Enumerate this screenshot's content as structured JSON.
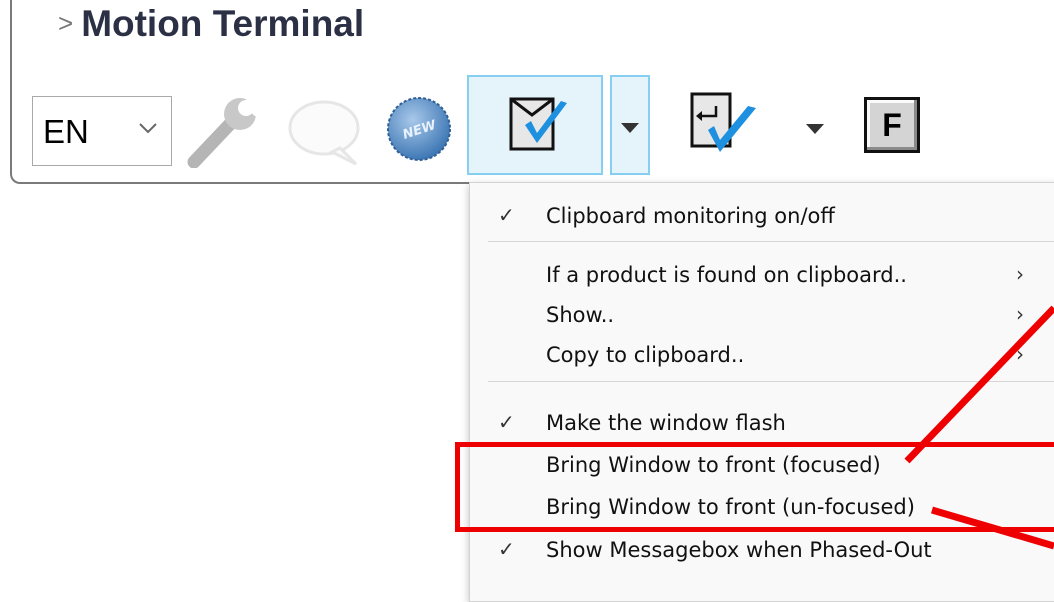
{
  "app": {
    "title": "Motion Terminal"
  },
  "toolbar": {
    "language": "EN",
    "icons": {
      "wrench": "wrench-icon",
      "bubble": "speech-bubble-icon",
      "new_badge": "new-badge-icon",
      "clipboard_check": "clipboard-check-icon",
      "clipboard_return_check": "clipboard-return-check-icon"
    },
    "new_badge_text": "NEW",
    "f_button_label": "F"
  },
  "menu": {
    "items": [
      {
        "label": "Clipboard monitoring on/off",
        "checked": true,
        "submenu": false
      },
      {
        "label": "If a product is found on clipboard..",
        "checked": false,
        "submenu": true
      },
      {
        "label": "Show..",
        "checked": false,
        "submenu": true
      },
      {
        "label": "Copy to clipboard..",
        "checked": false,
        "submenu": true
      },
      {
        "label": "Make the window flash",
        "checked": true,
        "submenu": false
      },
      {
        "label": "Bring Window to front (focused)",
        "checked": false,
        "submenu": false
      },
      {
        "label": "Bring Window to front (un-focused)",
        "checked": false,
        "submenu": false
      },
      {
        "label": "Show Messagebox when Phased-Out",
        "checked": true,
        "submenu": false
      }
    ],
    "check_glyph": "✓",
    "submenu_glyph": "›"
  },
  "colors": {
    "accent_blue": "#1e90e0",
    "highlight_fill": "#e5f3fb",
    "highlight_border": "#86cff0",
    "annotation_red": "#ee0000"
  }
}
